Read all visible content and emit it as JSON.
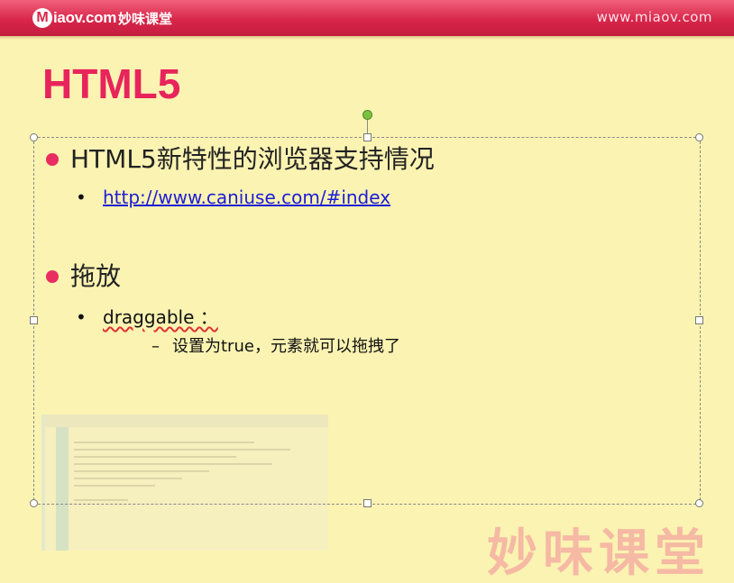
{
  "header": {
    "logo_mark": "M",
    "logo_text": "iaov.com",
    "logo_cn": "妙味课堂",
    "site_url": "www.miaov.com"
  },
  "slide": {
    "title": "HTML5",
    "sections": [
      {
        "heading": "HTML5新特性的浏览器支持情况",
        "items": [
          {
            "text": "http://www.caniuse.com/#index",
            "type": "link"
          }
        ]
      },
      {
        "heading": "拖放",
        "items": [
          {
            "text": "draggable ：",
            "type": "text",
            "subitems": [
              {
                "dash": "–",
                "text": "设置为true，元素就可以拖拽了"
              }
            ]
          }
        ]
      }
    ]
  },
  "watermark": {
    "brand": "妙味课堂"
  },
  "colors": {
    "header": "#d8264a",
    "title": "#e8245c",
    "bullet": "#ea2d60",
    "background": "#fbf3b2",
    "link": "#1d1dd6"
  }
}
